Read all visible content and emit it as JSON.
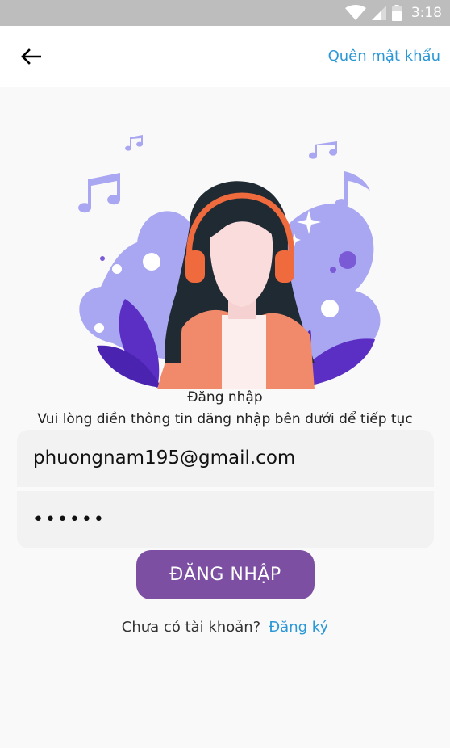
{
  "status_bar": {
    "time": "3:18",
    "icons": [
      "wifi-icon",
      "signal-icon",
      "battery-icon"
    ]
  },
  "app_bar": {
    "back_icon": "arrow-left-icon",
    "forgot_password_label": "Quên mật khẩu"
  },
  "illustration": {
    "name": "girl-with-headphones-music-illustration",
    "colors": {
      "blob": "#a9a6f2",
      "leaf": "#5b2fc4",
      "hair": "#1f2a33",
      "headphones": "#ef6a3c",
      "shirt": "#f08a6b"
    }
  },
  "login": {
    "title": "Đăng nhập",
    "subtitle": "Vui lòng điền thông tin đăng nhập bên dưới để tiếp tục"
  },
  "form": {
    "email_value": "phuongnam195@gmail.com",
    "password_value": "123456"
  },
  "actions": {
    "login_button_label": "ĐĂNG NHẬP"
  },
  "signup": {
    "prompt": "Chưa có tài khoản?",
    "link_label": "Đăng ký"
  },
  "theme": {
    "accent": "#7c4fa2",
    "link": "#2a97d6",
    "status_bar": "#bdbdbd",
    "background": "#f9f9f9"
  }
}
